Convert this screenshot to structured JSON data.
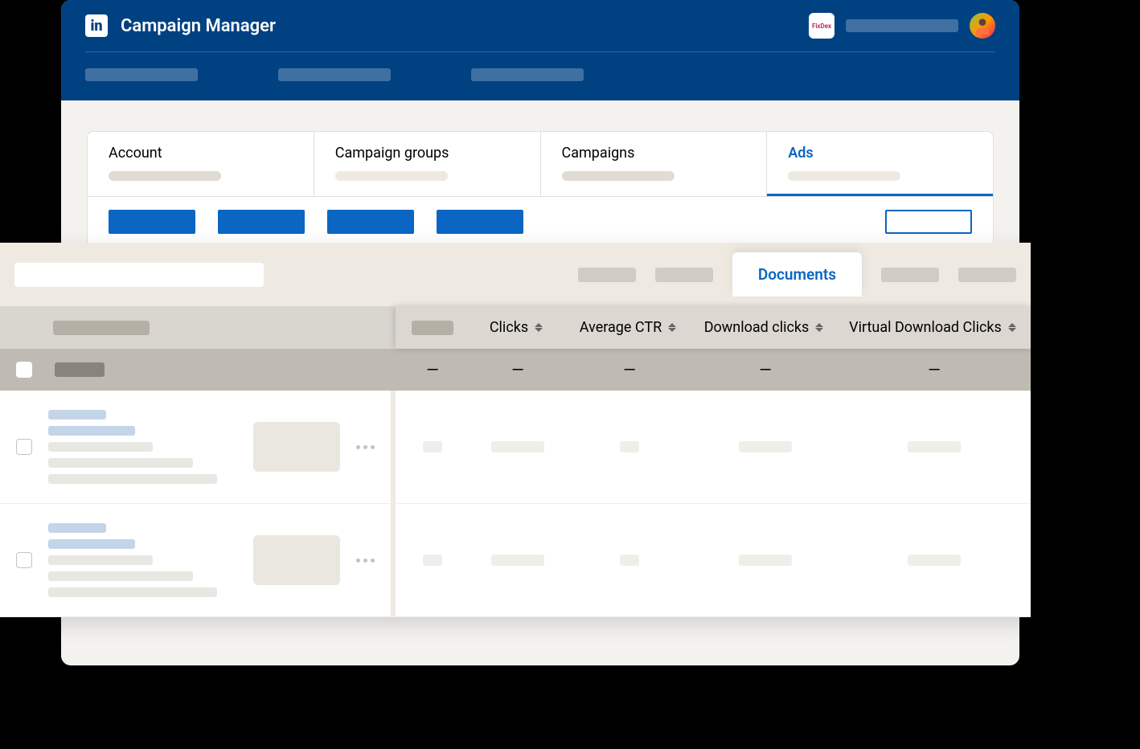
{
  "header": {
    "app_title": "Campaign Manager",
    "logo_text": "in",
    "fixdex_label": "FixDex"
  },
  "tabs": [
    {
      "label": "Account",
      "active": false
    },
    {
      "label": "Campaign groups",
      "active": false
    },
    {
      "label": "Campaigns",
      "active": false
    },
    {
      "label": "Ads",
      "active": true
    }
  ],
  "filter_active_tab": "Documents",
  "table": {
    "columns": [
      {
        "label": "Clicks"
      },
      {
        "label": "Average CTR"
      },
      {
        "label": "Download clicks"
      },
      {
        "label": "Virtual Download Clicks"
      }
    ],
    "summary_values": [
      "—",
      "—",
      "—",
      "—",
      "—"
    ],
    "rows": [
      {
        "values": [
          "—",
          "",
          "—",
          "",
          ""
        ]
      },
      {
        "values": [
          "—",
          "",
          "—",
          "",
          ""
        ]
      }
    ]
  }
}
